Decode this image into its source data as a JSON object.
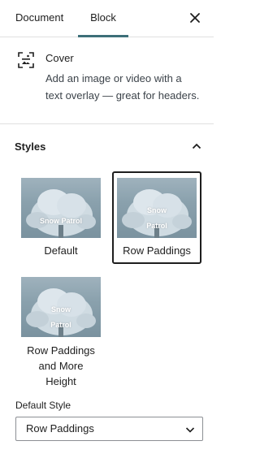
{
  "tabs": [
    {
      "label": "Document"
    },
    {
      "label": "Block"
    }
  ],
  "active_tab": "Block",
  "close_icon": "close-icon",
  "block": {
    "icon": "cover-icon",
    "title": "Cover",
    "description": "Add an image or video with a text overlay — great for headers."
  },
  "styles_panel": {
    "title": "Styles",
    "toggle_icon": "chevron-up-icon",
    "options": [
      {
        "thumbnail_text": "Snow Patrol",
        "label": "Default",
        "selected": false
      },
      {
        "thumbnail_text_line1": "Snow",
        "thumbnail_text_line2": "Patrol",
        "label": "Row Paddings",
        "selected": true
      },
      {
        "thumbnail_text_line1": "Snow",
        "thumbnail_text_line2": "Patrol",
        "label_line1": "Row Paddings",
        "label_line2": "and More",
        "label_line3": "Height",
        "selected": false
      }
    ]
  },
  "default_style": {
    "label": "Default Style",
    "value": "Row Paddings",
    "icon": "chevron-down-icon"
  },
  "colors": {
    "tab_indicator": "#3d6f79",
    "selected_border": "#1e1e1e"
  }
}
